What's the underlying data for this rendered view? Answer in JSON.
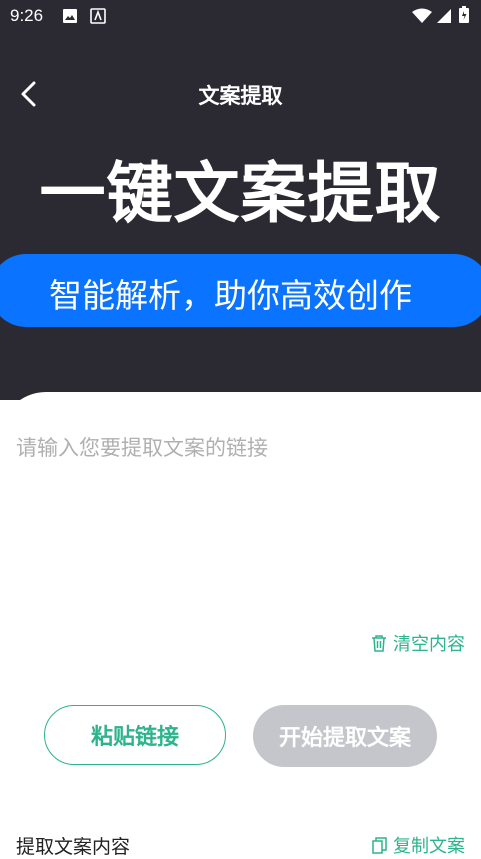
{
  "status_bar": {
    "time": "9:26"
  },
  "nav": {
    "title": "文案提取"
  },
  "hero": {
    "headline": "一键文案提取",
    "slogan": "智能解析，助你高效创作"
  },
  "input": {
    "placeholder": "请输入您要提取文案的链接",
    "value": ""
  },
  "actions": {
    "clear_label": "清空内容",
    "paste_label": "粘贴链接",
    "start_label": "开始提取文案"
  },
  "result": {
    "label": "提取文案内容",
    "copy_label": "复制文案"
  },
  "colors": {
    "accent": "#2db38d",
    "brand_blue": "#0a73ff",
    "hero_bg": "#2b2a33",
    "disabled": "#c4c6cc"
  }
}
